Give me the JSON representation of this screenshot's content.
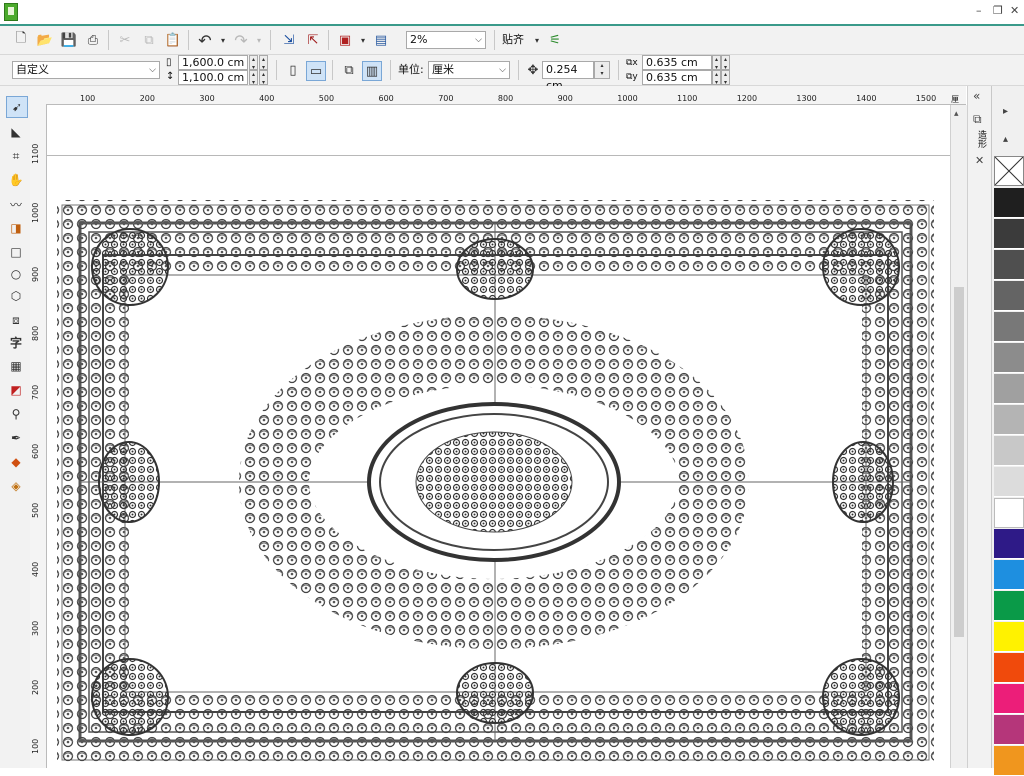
{
  "toolbar": {
    "zoom_value": "2%",
    "snap_label": "贴齐"
  },
  "property_bar": {
    "page_preset": "自定义",
    "width_value": "1,600.0 cm",
    "height_value": "1,100.0 cm",
    "units_label": "单位:",
    "units_value": "厘米",
    "nudge_value": "0.254 cm",
    "dup_x_value": "0.635 cm",
    "dup_y_value": "0.635 cm"
  },
  "rulers": {
    "h_ticks": [
      "100",
      "200",
      "300",
      "400",
      "500",
      "600",
      "700",
      "800",
      "900",
      "1000",
      "1100",
      "1200",
      "1300",
      "1400",
      "1500"
    ],
    "h_unit": "厘米",
    "v_ticks": [
      "1100",
      "1000",
      "900",
      "800",
      "700",
      "600",
      "500",
      "400",
      "300",
      "200",
      "100"
    ]
  },
  "docker": {
    "tab_label": "造形"
  },
  "palette": {
    "colors": [
      "#1f1f1f",
      "#3b3b3b",
      "#4f4f4f",
      "#646464",
      "#787878",
      "#8c8c8c",
      "#a0a0a0",
      "#b4b4b4",
      "#c8c8c8",
      "#dcdcdc",
      "#ffffff",
      "#2e1a87",
      "#1e8fe0",
      "#0a9a48",
      "#fff200",
      "#f04a0c",
      "#ec1e79",
      "#b5367a",
      "#f0961e"
    ]
  },
  "icons": [
    "new-icon",
    "open-icon",
    "save-icon",
    "print-icon",
    "cut-icon",
    "copy-icon",
    "paste-icon",
    "undo-icon",
    "redo-icon",
    "import-icon",
    "export-icon",
    "publish-icon",
    "app-launcher-icon",
    "options-icon",
    "pick-tool-icon",
    "shape-tool-icon",
    "crop-tool-icon",
    "zoom-tool-icon",
    "freehand-tool-icon",
    "smart-fill-icon",
    "rectangle-tool-icon",
    "ellipse-tool-icon",
    "polygon-tool-icon",
    "basic-shapes-icon",
    "text-tool-icon",
    "table-tool-icon",
    "interactive-tool-icon",
    "eyedropper-icon",
    "outline-icon",
    "fill-icon",
    "interactive-fill-icon"
  ]
}
